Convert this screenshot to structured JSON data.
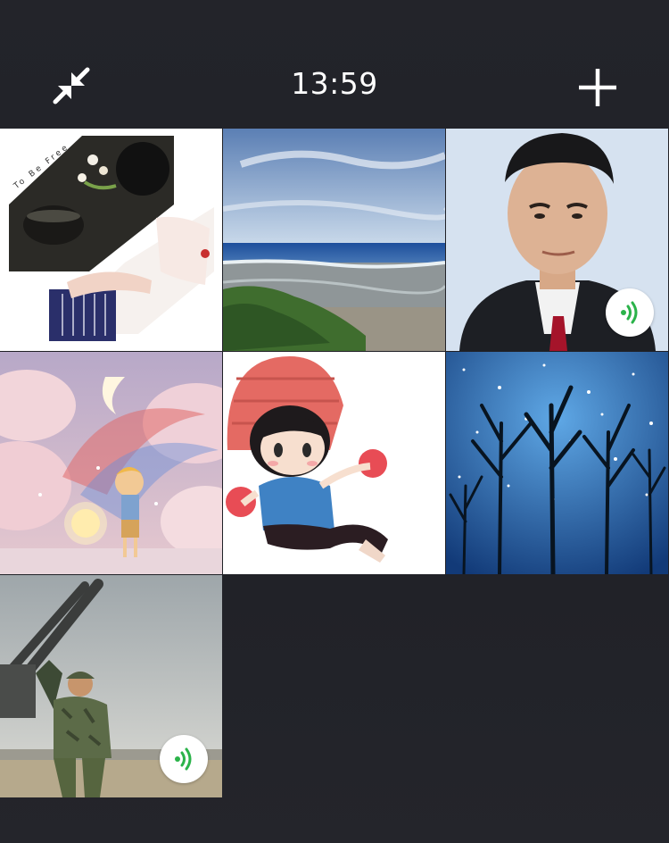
{
  "status": {
    "time": "13:59"
  },
  "toolbar": {
    "minimize_icon": "minimize-arrows-icon",
    "add_icon": "plus-icon"
  },
  "participants": [
    {
      "id": "p1",
      "avatar": "tea-guzheng-collage",
      "caption": "To Be Free",
      "speaking": false
    },
    {
      "id": "p2",
      "avatar": "seaside-reef",
      "speaking": false
    },
    {
      "id": "p3",
      "avatar": "man-in-suit-portrait",
      "speaking": true
    },
    {
      "id": "p4",
      "avatar": "fantasy-boy-moon-clouds",
      "speaking": false
    },
    {
      "id": "p5",
      "avatar": "chibi-girl-red-hat",
      "speaking": false
    },
    {
      "id": "p6",
      "avatar": "starry-forest",
      "speaking": false
    },
    {
      "id": "p7",
      "avatar": "soldier-with-anti-aircraft-gun",
      "speaking": true
    }
  ],
  "colors": {
    "background": "#1f2026",
    "speaking_indicator": "#2bb34a",
    "badge_bg": "#ffffff"
  }
}
